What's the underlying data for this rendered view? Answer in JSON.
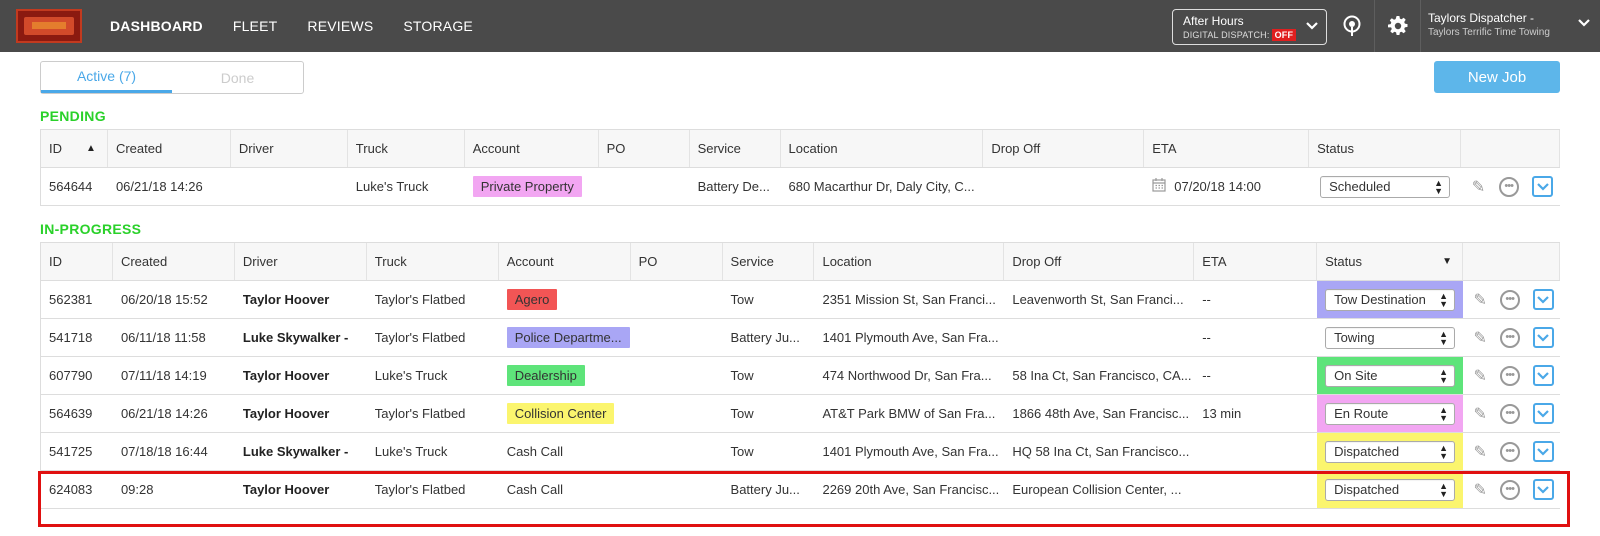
{
  "nav": {
    "items": [
      {
        "label": "DASHBOARD",
        "active": true
      },
      {
        "label": "FLEET"
      },
      {
        "label": "REVIEWS"
      },
      {
        "label": "STORAGE"
      }
    ]
  },
  "after_hours": {
    "title": "After Hours",
    "sub": "DIGITAL DISPATCH:",
    "state": "OFF"
  },
  "user": {
    "name": "Taylors Dispatcher -",
    "org": "Taylors Terrific Time Towing"
  },
  "tabs": [
    {
      "label": "Active (7)",
      "active": true
    },
    {
      "label": "Done"
    }
  ],
  "new_job_label": "New Job",
  "pending": {
    "label": "PENDING",
    "headers": [
      "ID",
      "Created",
      "Driver",
      "Truck",
      "Account",
      "PO",
      "Service",
      "Location",
      "Drop Off",
      "ETA",
      "Status"
    ],
    "rows": [
      {
        "id": "564644",
        "created": "06/21/18 14:26",
        "driver": "",
        "truck": "Luke's Truck",
        "account": "Private Property",
        "account_color": "#f2a6f2",
        "po": "",
        "service": "Battery De...",
        "location": "680 Macarthur Dr, Daly City, C...",
        "dropoff": "",
        "eta": "07/20/18 14:00",
        "status": "Scheduled"
      }
    ]
  },
  "inprogress": {
    "label": "IN-PROGRESS",
    "headers": [
      "ID",
      "Created",
      "Driver",
      "Truck",
      "Account",
      "PO",
      "Service",
      "Location",
      "Drop Off",
      "ETA",
      "Status"
    ],
    "rows": [
      {
        "id": "562381",
        "created": "06/20/18 15:52",
        "driver": "Taylor Hoover",
        "truck": "Taylor's Flatbed",
        "account": "Agero",
        "account_color": "#f25555",
        "po": "",
        "service": "Tow",
        "location": "2351 Mission St, San Franci...",
        "dropoff": "Leavenworth St, San Franci...",
        "eta": "--",
        "status": "Tow Destination",
        "status_color": "#a9a6f5"
      },
      {
        "id": "541718",
        "created": "06/11/18 11:58",
        "driver": "Luke Skywalker -",
        "truck": "Taylor's Flatbed",
        "account": "Police Departme...",
        "account_color": "#a9a6f5",
        "po": "",
        "service": "Battery Ju...",
        "location": "1401 Plymouth Ave, San Fra...",
        "dropoff": "",
        "eta": "--",
        "status": "Towing",
        "status_color": ""
      },
      {
        "id": "607790",
        "created": "07/11/18 14:19",
        "driver": "Taylor Hoover",
        "truck": "Luke's Truck",
        "account": "Dealership",
        "account_color": "#5ee47a",
        "po": "",
        "service": "Tow",
        "location": "474 Northwood Dr, San Fra...",
        "dropoff": "58 Ina Ct, San Francisco, CA...",
        "eta": "--",
        "status": "On Site",
        "status_color": "#5ee47a"
      },
      {
        "id": "564639",
        "created": "06/21/18 14:26",
        "driver": "Taylor Hoover",
        "truck": "Taylor's Flatbed",
        "account": "Collision Center",
        "account_color": "#fbf56e",
        "po": "",
        "service": "Tow",
        "location": "AT&T Park BMW of San Fra...",
        "dropoff": "1866 48th Ave, San Francisc...",
        "eta": "13 min",
        "status": "En Route",
        "status_color": "#f2a6f2"
      },
      {
        "id": "541725",
        "created": "07/18/18 16:44",
        "driver": "Luke Skywalker -",
        "truck": "Luke's Truck",
        "account": "Cash Call",
        "account_color": "",
        "po": "",
        "service": "Tow",
        "location": "1401 Plymouth Ave, San Fra...",
        "dropoff": "HQ 58 Ina Ct, San Francisco...",
        "eta": "",
        "status": "Dispatched",
        "status_color": "#fbf56e"
      },
      {
        "id": "624083",
        "created": "09:28",
        "driver": "Taylor Hoover",
        "truck": "Taylor's Flatbed",
        "account": "Cash Call",
        "account_color": "",
        "po": "",
        "service": "Battery Ju...",
        "location": "2269 20th Ave, San Francisc...",
        "dropoff": "European Collision Center, ...",
        "eta": "",
        "status": "Dispatched",
        "status_color": "#fbf56e"
      }
    ]
  },
  "colors": {
    "accent": "#4aa8e8",
    "section_green": "#2ad12a",
    "header_bg": "#4a4a4a",
    "highlight": "#e01010"
  }
}
